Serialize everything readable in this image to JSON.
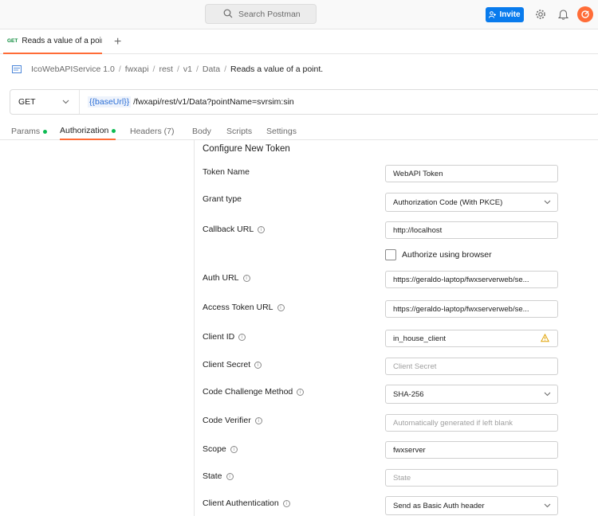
{
  "header": {
    "search_placeholder": "Search Postman",
    "invite_label": "Invite"
  },
  "tabs": [
    {
      "method": "GET",
      "label": "Reads a value of a poir",
      "unsaved": true
    }
  ],
  "breadcrumb": [
    "IcoWebAPIService 1.0",
    "fwxapi",
    "rest",
    "v1",
    "Data",
    "Reads a value of a point."
  ],
  "request": {
    "method": "GET",
    "url_variable": "{{baseUrl}}",
    "url_path": "/fwxapi/rest/v1/Data?pointName=svrsim:sin"
  },
  "request_tabs": [
    {
      "label": "Params",
      "dot": true
    },
    {
      "label": "Authorization",
      "dot": true,
      "active": true
    },
    {
      "label": "Headers (7)",
      "dot": false
    },
    {
      "label": "Body",
      "dot": false
    },
    {
      "label": "Scripts",
      "dot": false
    },
    {
      "label": "Settings",
      "dot": false
    }
  ],
  "token_form": {
    "title": "Configure New Token",
    "token_name": {
      "label": "Token Name",
      "value": "WebAPI Token"
    },
    "grant_type": {
      "label": "Grant type",
      "value": "Authorization Code (With PKCE)"
    },
    "callback_url": {
      "label": "Callback URL",
      "value": "http://localhost"
    },
    "authorize_browser": {
      "label": "Authorize using browser",
      "checked": false
    },
    "auth_url": {
      "label": "Auth URL",
      "value": "https://geraldo-laptop/fwxserverweb/se..."
    },
    "access_token_url": {
      "label": "Access Token URL",
      "value": "https://geraldo-laptop/fwxserverweb/se..."
    },
    "client_id": {
      "label": "Client ID",
      "value": "in_house_client"
    },
    "client_secret": {
      "label": "Client Secret",
      "placeholder": "Client Secret"
    },
    "code_challenge": {
      "label": "Code Challenge Method",
      "value": "SHA-256"
    },
    "code_verifier": {
      "label": "Code Verifier",
      "placeholder": "Automatically generated if left blank"
    },
    "scope": {
      "label": "Scope",
      "value": "fwxserver"
    },
    "state": {
      "label": "State",
      "placeholder": "State"
    },
    "client_auth": {
      "label": "Client Authentication",
      "value": "Send as Basic Auth header"
    }
  },
  "colors": {
    "accent": "#ff6c37",
    "invite": "#097bed",
    "status_dot": "#0cbb52",
    "warning": "#e0a100"
  }
}
